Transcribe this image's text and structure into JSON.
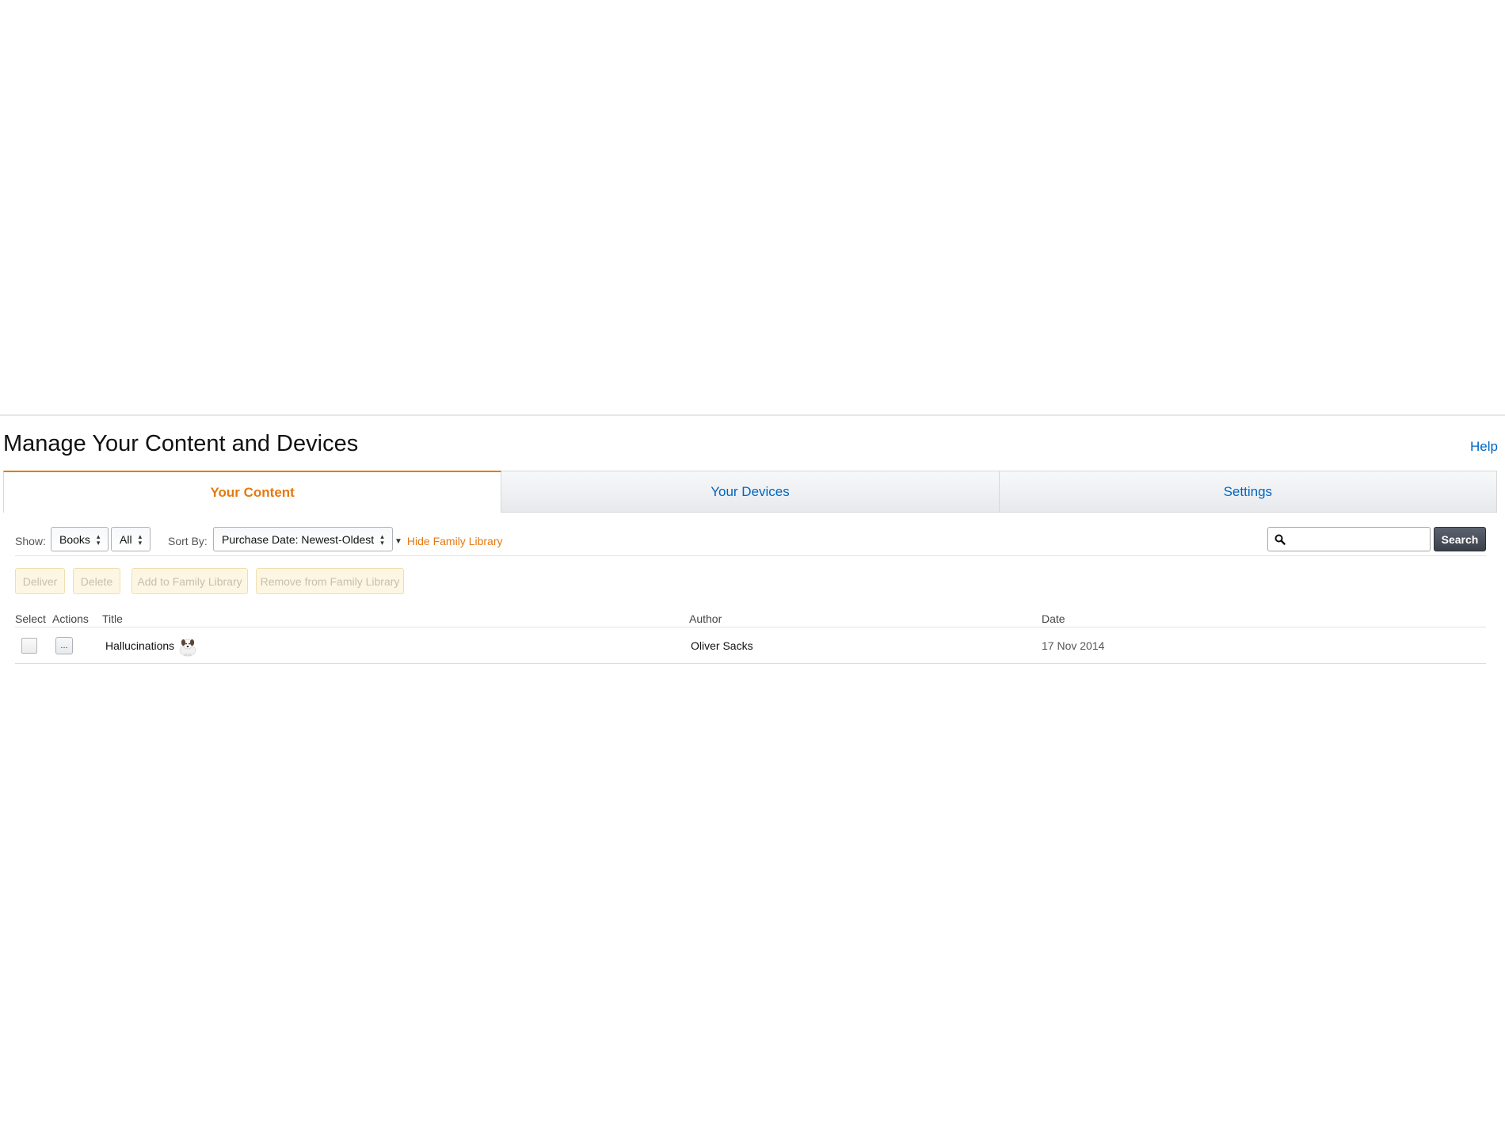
{
  "header": {
    "title": "Manage Your Content and Devices",
    "help_label": "Help"
  },
  "tabs": [
    {
      "label": "Your Content",
      "active": true
    },
    {
      "label": "Your Devices",
      "active": false
    },
    {
      "label": "Settings",
      "active": false
    }
  ],
  "filters": {
    "show_label": "Show:",
    "show_value": "Books",
    "subset_value": "All",
    "sort_label": "Sort By:",
    "sort_value": "Purchase Date: Newest-Oldest",
    "family_toggle_label": "Hide Family Library"
  },
  "search": {
    "placeholder": "",
    "button_label": "Search"
  },
  "actions": {
    "deliver": "Deliver",
    "delete": "Delete",
    "add_family": "Add to Family Library",
    "remove_family": "Remove from Family Library"
  },
  "table": {
    "columns": {
      "select": "Select",
      "actions": "Actions",
      "title": "Title",
      "author": "Author",
      "date": "Date"
    },
    "rows": [
      {
        "more_label": "...",
        "title": "Hallucinations",
        "author": "Oliver Sacks",
        "date": "17 Nov 2014"
      }
    ]
  },
  "colors": {
    "accent_orange": "#e47911",
    "link_blue": "#0066c0",
    "search_button": "#3b414a"
  },
  "icons": {
    "search": "magnifier-icon",
    "family": "dog-avatar-icon",
    "caret": "up-down-caret-icon"
  }
}
